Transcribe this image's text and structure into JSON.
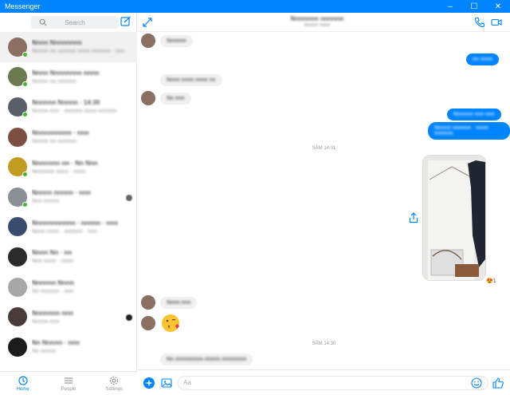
{
  "window": {
    "title": "Messenger",
    "minimize": "–",
    "maximize": "☐",
    "close": "✕"
  },
  "search": {
    "placeholder": "Search"
  },
  "chats": [
    {
      "name": "Nnnn Nnnnnnnn",
      "snippet": "Nnnnn nn nnnnnn nnnn nnnnnn · nnn",
      "active": true,
      "online": true,
      "color": "#8a6f62"
    },
    {
      "name": "Nnnn Nnnnnnnn nnnn",
      "snippet": "Nnnnn nn nnnnnn",
      "online": true,
      "color": "#6c7a4f"
    },
    {
      "name": "Nnnnnn Nnnnn · 14:30",
      "snippet": "Nnnnn nnn · nnnnnn nnnn nnnnnn",
      "online": true,
      "color": "#5a5e66"
    },
    {
      "name": "Nnnnnnnnnn · nnn",
      "snippet": "Nnnnn nn nnnnnn",
      "online": false,
      "color": "#7d4e44"
    },
    {
      "name": "Nnnnnnn nn · Nn Nnn",
      "snippet": "Nnnnnnn nnnn · nnnn",
      "online": true,
      "color": "#c29b22"
    },
    {
      "name": "Nnnnn nnnnn · nnn",
      "snippet": "Nnn nnnnn",
      "online": true,
      "color": "#8b8f96"
    },
    {
      "name": "Nnnnnnnnnnn · nnnnn · nnn",
      "snippet": "Nnnn nnnn · nnnnnn · nnn",
      "online": false,
      "color": "#3a4b6d"
    },
    {
      "name": "Nnnn Nn · nn",
      "snippet": "Nnn nnnn · nnnn",
      "online": false,
      "color": "#2b2b2b"
    },
    {
      "name": "Nnnnnn Nnnn",
      "snippet": "Nn nnnnnn · nnn",
      "online": false,
      "color": "#a7a7a7"
    },
    {
      "name": "Nnnnnnn nnn",
      "snippet": "Nnnnn nnn",
      "online": false,
      "color": "#4a3b3b"
    },
    {
      "name": "Nn Nnnnn · nnn",
      "snippet": "Nn nnnnn",
      "online": false,
      "color": "#1c1c1c"
    }
  ],
  "tabs": {
    "home": "Home",
    "people": "People",
    "settings": "Settings"
  },
  "header": {
    "name": "Nnnnnnn nnnnnn",
    "status": "Nnnnn nnnn"
  },
  "messages": {
    "in1": "Nnnnnn",
    "out1": "nn nnnn",
    "in2": "Nnnn nnnn nnnn nn",
    "in3": "Nn nnn",
    "out2": "Nnnnnn nnn nnn",
    "out3": "Nnnnn nnnnnn · nnnn nnnnnn",
    "ts1": "SÂM 14:01",
    "reaction_count": "1",
    "in4": "Nnnn nnn",
    "ts2": "SÂM 14:30",
    "in5": "Nn nnnnnnnnn nnnnn nnnnnnnn"
  },
  "composer": {
    "placeholder": "Aa"
  },
  "colors": {
    "accent": "#0084ff",
    "online": "#42b72a"
  }
}
